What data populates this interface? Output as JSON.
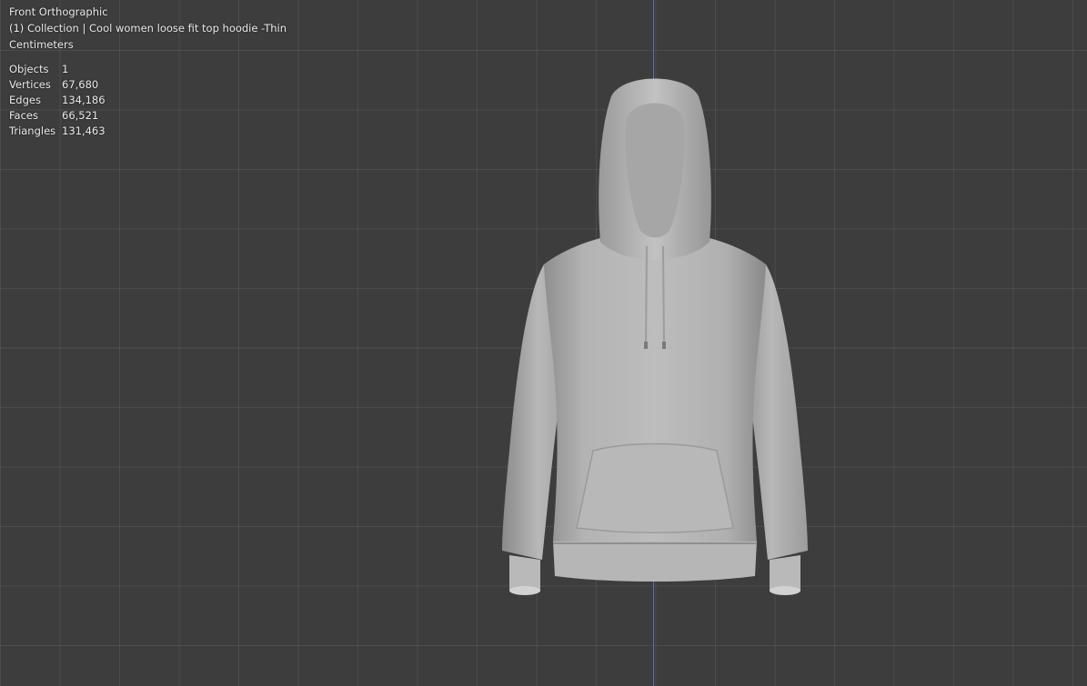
{
  "viewport": {
    "view_name": "Front Orthographic",
    "collection_line": "(1) Collection | Cool women loose fit top hoodie -Thin",
    "units": "Centimeters"
  },
  "stats": [
    {
      "label": "Objects",
      "value": "1"
    },
    {
      "label": "Vertices",
      "value": "67,680"
    },
    {
      "label": "Edges",
      "value": "134,186"
    },
    {
      "label": "Faces",
      "value": "66,521"
    },
    {
      "label": "Triangles",
      "value": "131,463"
    }
  ],
  "colors": {
    "background": "#3d3d3d",
    "axis": "#5a7bbf",
    "model": "#b4b4b4"
  },
  "model": {
    "icon": "hoodie-mesh"
  }
}
